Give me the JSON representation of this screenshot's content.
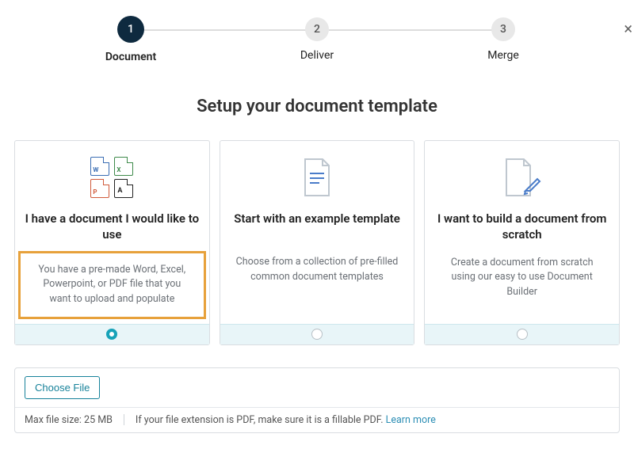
{
  "close": "×",
  "stepper": {
    "steps": [
      {
        "num": "1",
        "label": "Document",
        "active": true
      },
      {
        "num": "2",
        "label": "Deliver",
        "active": false
      },
      {
        "num": "3",
        "label": "Merge",
        "active": false
      }
    ]
  },
  "page_title": "Setup your document template",
  "cards": [
    {
      "title": "I have a document I would like to use",
      "desc": "You have a pre-made Word, Excel, Powerpoint, or PDF file that you want to upload and populate",
      "selected": true,
      "highlighted": true,
      "icons": {
        "word": "W",
        "excel": "X",
        "ppt": "P",
        "pdf": "A"
      }
    },
    {
      "title": "Start with an example template",
      "desc": "Choose from a collection of pre-filled common document templates",
      "selected": false,
      "highlighted": false
    },
    {
      "title": "I want to build a document from scratch",
      "desc": "Create a document from scratch using our easy to use Document Builder",
      "selected": false,
      "highlighted": false
    }
  ],
  "file_panel": {
    "choose_label": "Choose File",
    "max_size": "Max file size: 25 MB",
    "pdf_note": "If your file extension is PDF, make sure it is a fillable PDF.",
    "learn_more": "Learn more"
  }
}
